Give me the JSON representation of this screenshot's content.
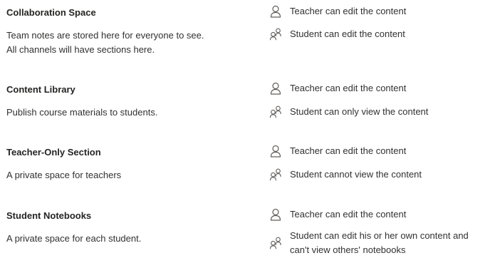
{
  "sections": [
    {
      "title": "Collaboration Space",
      "description": "Team notes are stored here for everyone to see. All channels will have sections here.",
      "teacher_permission": "Teacher can edit the content",
      "student_permission": "Student can edit the content"
    },
    {
      "title": "Content Library",
      "description": "Publish course materials to students.",
      "teacher_permission": "Teacher can edit the content",
      "student_permission": "Student can only view the content"
    },
    {
      "title": "Teacher-Only Section",
      "description": "A private space for teachers",
      "teacher_permission": "Teacher can edit the content",
      "student_permission": "Student cannot view the content"
    },
    {
      "title": "Student Notebooks",
      "description": "A private space for each student.",
      "teacher_permission": "Teacher can edit the content",
      "student_permission": "Student can edit his or her own content and can't view others' notebooks"
    }
  ],
  "icons": {
    "teacher": "person-icon",
    "student": "people-icon"
  },
  "colors": {
    "text": "#252423",
    "icon": "#605e5c"
  }
}
